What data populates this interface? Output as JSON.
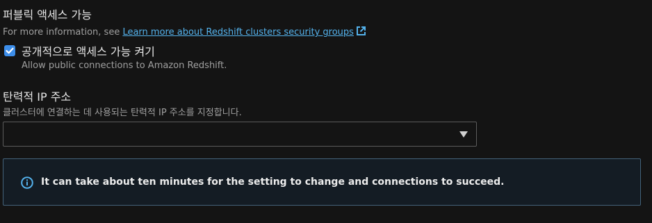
{
  "public_access": {
    "title": "퍼블릭 액세스 가능",
    "description_prefix": "For more information, see ",
    "link_label": "Learn more about Redshift clusters security groups"
  },
  "checkbox": {
    "checked": true,
    "label": "공개적으로 액세스 가능 켜기",
    "description": "Allow public connections to Amazon Redshift."
  },
  "elastic_ip": {
    "title": "탄력적 IP 주소",
    "description": "클러스터에 연결하는 데 사용되는 탄력적 IP 주소를 지정합니다.",
    "selected_value": ""
  },
  "info_alert": {
    "message": "It can take about ten minutes for the setting to change and connections to succeed."
  },
  "colors": {
    "accent": "#3d8eea",
    "link": "#54b2ec",
    "info_border": "#44627a"
  }
}
